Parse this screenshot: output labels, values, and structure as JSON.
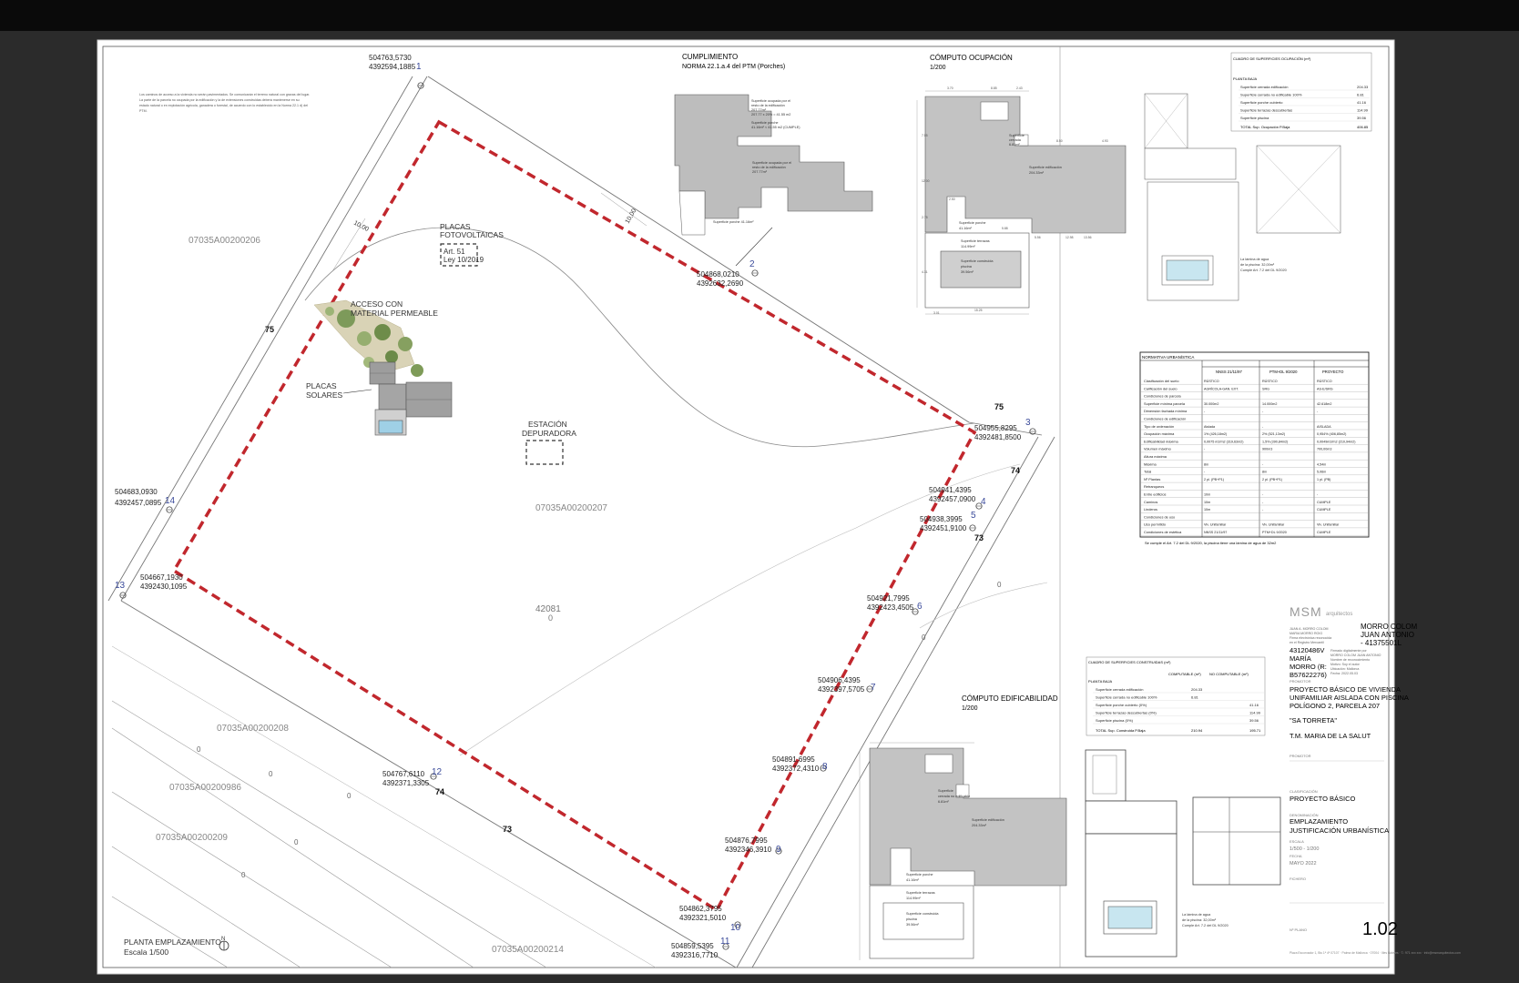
{
  "parcel": {
    "name": "07035A00200207",
    "area": "42081",
    "area_zero": "0",
    "neighbours": [
      "07035A00200206",
      "07035A00200208",
      "07035A00200986",
      "07035A00200209",
      "07035A00200214"
    ],
    "contour_labels": [
      "75",
      "75",
      "74",
      "73",
      "74",
      "73"
    ],
    "setback_labels": [
      "10,00",
      "10,00"
    ],
    "small_zeros": [
      "0",
      "0",
      "0",
      "0",
      "0",
      "0",
      "0"
    ],
    "vertices": [
      {
        "n": "1",
        "e": "504763,5730",
        "nn": "4392594,1885"
      },
      {
        "n": "2",
        "e": "504868,0210",
        "nn": "4392632,2690"
      },
      {
        "n": "3",
        "e": "504955,8295",
        "nn": "4392481,8500"
      },
      {
        "n": "4",
        "e": "504941,4395",
        "nn": "4392457,0900"
      },
      {
        "n": "5",
        "e": "504938,3995",
        "nn": "4392451,9100"
      },
      {
        "n": "6",
        "e": "504921,7995",
        "nn": "4392423,4505"
      },
      {
        "n": "7",
        "e": "504906,4395",
        "nn": "4392397,5705"
      },
      {
        "n": "8",
        "e": "504891,6995",
        "nn": "4392372,4310"
      },
      {
        "n": "9",
        "e": "504876,7995",
        "nn": "4392346,3910"
      },
      {
        "n": "10",
        "e": "504862,3795",
        "nn": "4392321,5010"
      },
      {
        "n": "11",
        "e": "504859,5395",
        "nn": "4392316,7710"
      },
      {
        "n": "12",
        "e": "504767,6110",
        "nn": "4392371,3305"
      },
      {
        "n": "13",
        "e": "504667,1930",
        "nn": "4392430,1095"
      },
      {
        "n": "14",
        "e": "504683,0930",
        "nn": "4392457,0895"
      }
    ]
  },
  "annotations": {
    "fotovoltaicas": [
      "PLACAS",
      "FOTOVOLTAICAS"
    ],
    "art51": [
      "Art. 51",
      "Ley 10/2019"
    ],
    "acceso": [
      "ACCESO CON",
      "MATERIAL PERMEABLE"
    ],
    "solares": [
      "PLACAS",
      "SOLARES"
    ],
    "depuradora": [
      "ESTACIÓN",
      "DEPURADORA"
    ],
    "notes": [
      "Los caminos de acceso a la vivienda no serán pavimentados. Se comunicarán el terreno natural con gravas del lugar.",
      "La parte de la parcela no ocupada por la edificación y la de extensiones construidas deberá mantenerse en su",
      "estado natural o en explotación agrícola, ganadera o forestal, de acuerdo con lo establecido en la Norma 22.1 d) del",
      "PTM."
    ]
  },
  "cumplimiento": {
    "title": [
      "CUMPLIMIENTO",
      "NORMA 22.1.a.4 del PTM (Porches)"
    ],
    "note1": [
      "Superficie ocupada por el",
      "resto de la edificación",
      "207.77m²",
      "207.77 x 20% = 41.55 m2"
    ],
    "note2": [
      "Superficie porche",
      "41.16m² < 41.55 m2 (CUMPLE)"
    ],
    "note3": [
      "Superficie ocupada por el",
      "resto de la edificación",
      "207.77m²"
    ],
    "note4": "Superficie porche 41.16m²"
  },
  "ocupacion": {
    "title": [
      "CÓMPUTO OCUPACIÓN",
      "1/200"
    ],
    "labels": [
      [
        "Superficie",
        "cerrada",
        "no edificable",
        "6.81m²"
      ],
      [
        "Superficie edificación",
        "204.33m²"
      ],
      [
        "Superficie porche",
        "41.16m²"
      ],
      [
        "Superficie terrazas",
        "114.99m²"
      ],
      [
        "Superficie construida",
        "piscina",
        "39.56m²"
      ]
    ],
    "dims": [
      "3.70",
      "8.85",
      "2.43",
      "8.50",
      "4.93",
      "7.55",
      "12.00",
      "2.75",
      "4.31",
      "15.25",
      "5.56",
      "13.56",
      "2.50",
      "5.88",
      "12.98",
      "3.01"
    ],
    "pool_note": [
      "La lámina de agua",
      "de la piscina: 32,00m²",
      "Cumple Art. 7.2 del DL 9/2020"
    ]
  },
  "cuadro_ocupacion": {
    "title": "CUADRO DE SUPERFICIES OCUPACIÓN (m²)",
    "subtitle": "PLANTA BAJA",
    "rows": [
      [
        "Superficie cerrada edificación",
        "204.33"
      ],
      [
        "Superficie cerrada no edificable 100%",
        "6.81"
      ],
      [
        "Superficie porche cubierto",
        "41.16"
      ],
      [
        "Superficie terrazas descubiertas",
        "114.99"
      ],
      [
        "Superficie piscina",
        "39.56"
      ]
    ],
    "total": [
      "TOTAL Sup. Ocupación P.Baja",
      "406.85"
    ]
  },
  "normativa": {
    "title": "NORMATIVA URBANÍSTICA",
    "headers": [
      "NNSS 21/11/97",
      "PTM+DL 9/2020",
      "PROYECTO"
    ],
    "rows": [
      [
        "Clasificación del suelo",
        "RÚSTICO",
        "RÚSTICO",
        "RÚSTICO"
      ],
      [
        "Calificación del suelo",
        "AGRÍCOLA-GAN. EXT.",
        "SRG",
        "AS-E/SRG"
      ],
      [
        "Condiciones de parcela",
        "",
        "",
        ""
      ],
      [
        "Superficie mínima parcela",
        "30.000m2",
        "14.000m2",
        "42.618m2"
      ],
      [
        "Dimensión fachada mínima",
        "-",
        "-",
        "-"
      ],
      [
        "Condiciones de edificación",
        "",
        "",
        ""
      ],
      [
        "Tipo de ordenación",
        "Aislada",
        "-",
        "AISLADA"
      ],
      [
        "Ocupación máxima",
        "1% (426,18m2)",
        "2% (521,13m2)",
        "0,954% (406,85m2)"
      ],
      [
        "Edificabilidad máxima",
        "0,0075 m2/m2 (319,63m2)",
        "1,5% (390,84m2)",
        "0,0049m2/m2 (210,94m2)"
      ],
      [
        "Volumen máximo",
        "-",
        "900m3",
        "700,00m3"
      ],
      [
        "Altura máxima",
        "",
        "",
        ""
      ],
      [
        "Máxima",
        "8m",
        "-",
        "4,54m"
      ],
      [
        "Total",
        "-",
        "8m",
        "5,06m"
      ],
      [
        "Nº Plantas",
        "2 pl. (PB+P1)",
        "2 pl. (PB+P1)",
        "1 pl. (PB)"
      ],
      [
        "Retranqueos",
        "",
        "",
        ""
      ],
      [
        "Entre edificios",
        "10m",
        "-",
        "-"
      ],
      [
        "Caminos",
        "10m",
        "-",
        "CUMPLE"
      ],
      [
        "Linderos",
        "10m",
        "-",
        "CUMPLE"
      ],
      [
        "Condiciones de uso",
        "",
        "",
        ""
      ],
      [
        "Uso permitido",
        "Viv. Unifamiliar",
        "Viv. Unifamiliar",
        "Viv. Unifamiliar"
      ],
      [
        "Condiciones de estética",
        "NNSS 21/11/97",
        "PTM+DL 9/2020",
        "CUMPLE"
      ]
    ],
    "footnote": "Se cumple el Art. 7.2 del DL 9/2020, la piscina tiene una lámina de agua de 32m2"
  },
  "cuadro_construidas": {
    "title": "CUADRO DE SUPERFICIES CONSTRUIDAS (m²)",
    "headers": [
      "COMPUTABLE (m²)",
      "NO COMPUTABLE (m²)"
    ],
    "subtitle": "PLANTA BAJA",
    "rows": [
      [
        "Superficie cerrada edificación",
        "204.33",
        ""
      ],
      [
        "Superficie cerrada no edificable 100%",
        "6.81",
        ""
      ],
      [
        "Superficie porche cubierto (0%)",
        "",
        "41.16"
      ],
      [
        "Superficie terrazas descubiertas (0%)",
        "",
        "114.99"
      ],
      [
        "Superficie piscina (0%)",
        "",
        "39.56"
      ]
    ],
    "total": [
      "TOTAL Sup. Construida P.Baja",
      "210.94",
      "195.71"
    ]
  },
  "edificabilidad": {
    "title": [
      "CÓMPUTO EDIFICABILIDAD",
      "1/200"
    ],
    "labels": [
      [
        "Superficie",
        "cerrada no edificable",
        "6.81m²"
      ],
      [
        "Superficie edificación",
        "204.33m²"
      ],
      [
        "Superficie porche",
        "41.16m²"
      ],
      [
        "Superficie terrazas",
        "114.99m²"
      ],
      [
        "Superficie construida",
        "piscina",
        "39.56m²"
      ]
    ],
    "pool_note": [
      "La lámina de agua",
      "de la piscina: 32,00m²",
      "Cumple Art. 7.2 del DL 9/2020"
    ]
  },
  "title_block": {
    "logo": "MSM",
    "logo_sub": "arquitectos",
    "owner": [
      "MORRO COLOM",
      "JUAN ANTONIO",
      "- 41375501L"
    ],
    "owner2": [
      "43120486V",
      "MARÍA",
      "MORRO (R:",
      "B57622276)"
    ],
    "fine_left": [
      "JUAN A. MORRO COLOM",
      "MARIA MORRO ROIG",
      "Firma electrónica reconocida",
      "en el Registro Mercantil"
    ],
    "fine_right": [
      "Firmado digitalmente por",
      "MORRO COLOM JUAN ANTONIO",
      "Nombre de reconocimiento",
      "Motivo: Soy el autor",
      "Ubicación: Mallorca",
      "Fecha: 2022.05.03"
    ],
    "promotor_label": "PROMOTOR",
    "project": [
      "PROYECTO BÁSICO DE VIVIENDA",
      "UNIFAMILIAR AISLADA CON PISCINA",
      "POLÍGONO 2, PARCELA 207"
    ],
    "name": "\"SA TORRETA\"",
    "municipality": "T.M. MARIA DE LA SALUT",
    "promotor2": "PROMOTOR",
    "clasif_label": "CLASIFICACIÓN",
    "clasif": "PROYECTO BÁSICO",
    "denom_label": "DENOMINACIÓN",
    "denom": [
      "EMPLAZAMIENTO",
      "JUSTIFICACIÓN URBANÍSTICA"
    ],
    "escala_label": "ESCALA",
    "escala": "1/500 - 1/200",
    "fecha_label": "FECHA",
    "fecha": "MAYO 2022",
    "fichero_label": "FICHERO",
    "plano_label": "Nº PLANO",
    "plano": "1.02",
    "footer": "Plaza Escorxador 1, Bis 1ª 4ª 07107 · Palma de Mallorca · 07004 · Illes Balears · T.: 971 xxx xxx · info@msmarquitectos.com"
  },
  "plan": {
    "title": "PLANTA EMPLAZAMIENTO",
    "scale": "Escala 1/500",
    "north": "N"
  }
}
